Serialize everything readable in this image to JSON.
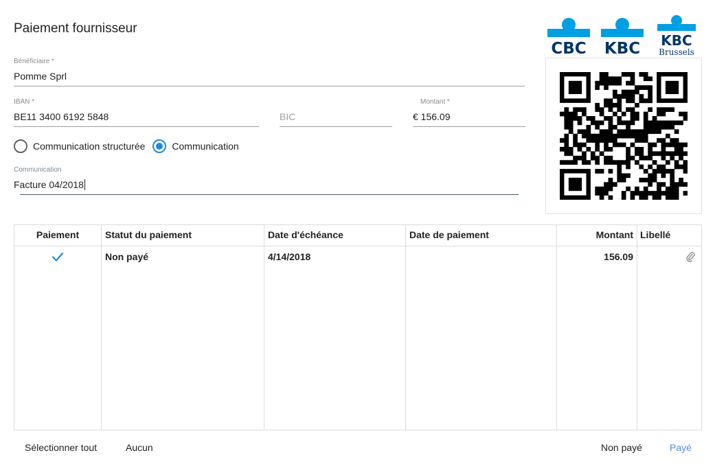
{
  "page": {
    "title": "Paiement fournisseur"
  },
  "form": {
    "beneficiary": {
      "label": "Bénéficiaire *",
      "value": "Pomme Sprl"
    },
    "iban": {
      "label": "IBAN *",
      "value": "BE11 3400 6192 5848"
    },
    "bic": {
      "placeholder": "BIC"
    },
    "amount": {
      "label": "Montant *",
      "value": "€ 156.09"
    },
    "communication_type": {
      "options": [
        {
          "label": "Communication structurée",
          "checked": false
        },
        {
          "label": "Communication",
          "checked": true
        }
      ]
    },
    "communication": {
      "label": "Communication",
      "value": "Facture 04/2018"
    }
  },
  "banks": [
    "CBC",
    "KBC",
    "KBC",
    "Brussels"
  ],
  "table": {
    "columns": [
      "Paiement",
      "Statut du paiement",
      "Date d'échéance",
      "Date de paiement",
      "Montant",
      "Libellé"
    ],
    "rows": [
      {
        "paiement_checked": true,
        "statut": "Non payé",
        "echeance": "4/14/2018",
        "date_paiement": "",
        "montant": "156.09",
        "libelle_icon": "paperclip-icon"
      }
    ]
  },
  "footer": {
    "select_all": "Sélectionner tout",
    "none": "Aucun",
    "unpaid": "Non payé",
    "paid": "Payé"
  },
  "colors": {
    "accent": "#1e88e5",
    "link": "#4a90e2",
    "kbc_blue": "#009fe3",
    "kbc_navy": "#003665"
  }
}
